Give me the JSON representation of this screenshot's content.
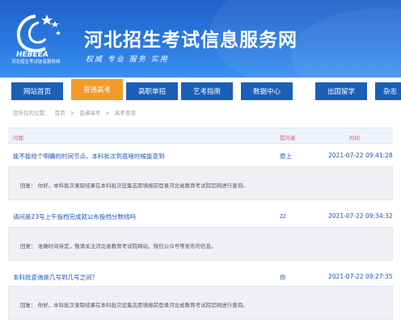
{
  "header": {
    "logo_text": "HEBEEA",
    "logo_subtitle": "河北招生考试信息服务网",
    "site_title": "河北招生考试信息服务网",
    "slogan": "权威  专业  服务  实用"
  },
  "nav": {
    "items": [
      {
        "label": "网站首页"
      },
      {
        "label": "普通高考",
        "active": true
      },
      {
        "label": "高职单招"
      },
      {
        "label": "艺考指南"
      },
      {
        "label": "数据中心"
      },
      {
        "label": "出国留学"
      },
      {
        "label": "杂志"
      }
    ]
  },
  "breadcrumb": {
    "prefix": "您所在的位置：",
    "items": [
      "首页",
      ">",
      "普通高考",
      ">",
      "高考咨询"
    ]
  },
  "table": {
    "headers": {
      "question": "问题",
      "asker": "提问者",
      "time": "时间"
    },
    "rows": [
      {
        "question": "能不能给个明确的时间节点，本科批次到底啥时候能查到",
        "asker": "原上",
        "time": "2021-07-22 09:41:28",
        "answer": "回复：  你好，本科批次录取结果在本科批次征集志愿填报前登录河北省教育考试院官网进行查询。"
      },
      {
        "question": "请问是23号上午投档完成就公布投档分数线吗",
        "asker": "zz",
        "time": "2021-07-22 09:34:32",
        "answer": "回复：  准确时间待定，敬请关注河北省教育考试院网站、微信公众号等发布的信息。"
      },
      {
        "question": "本科批查询是几号到几号之间？",
        "asker": "你",
        "time": "2021-07-22 09:27:35",
        "answer": "回复：  你好，本科批次录取结果在本科批次征集志愿填报前登录河北省教育考试院官网进行查询。"
      }
    ]
  },
  "colors": {
    "header_blue": "#2a79e0",
    "nav_blue": "#1a5fb8",
    "nav_active": "#f29b2a",
    "link_blue": "#1a56b8",
    "header_label": "#e25f5f"
  }
}
